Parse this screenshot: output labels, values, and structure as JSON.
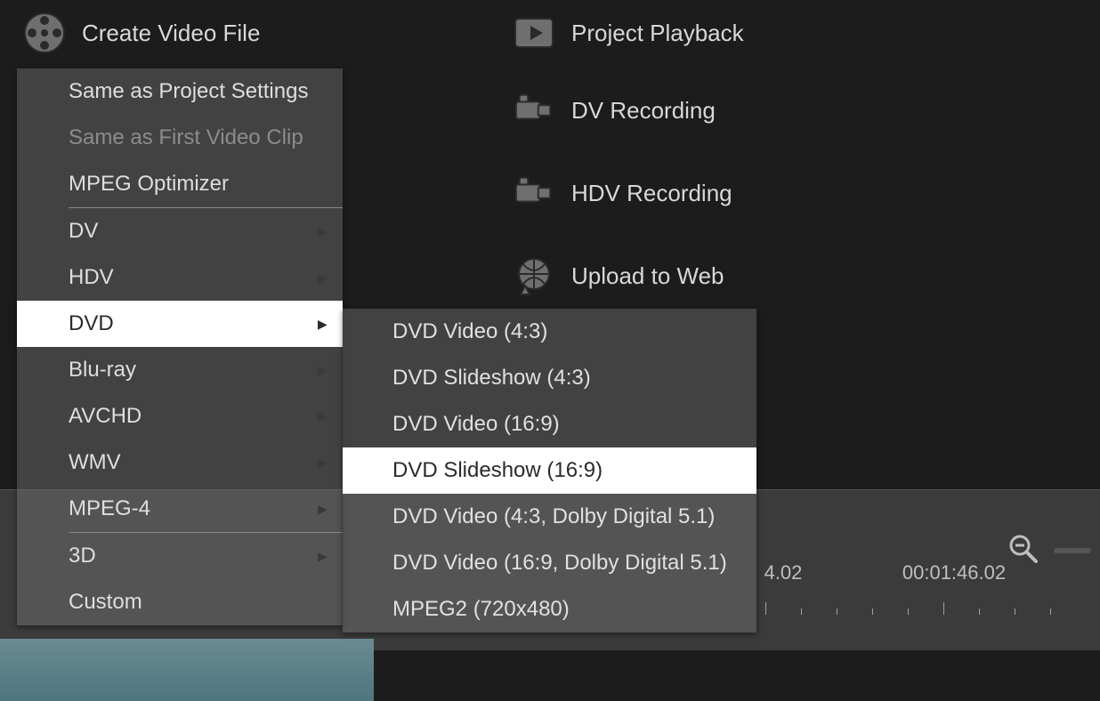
{
  "toolbar": {
    "create_video_file": "Create Video File",
    "project_playback": "Project Playback",
    "dv_recording": "DV Recording",
    "hdv_recording": "HDV Recording",
    "upload_to_web": "Upload to Web"
  },
  "menu": {
    "same_as_project_settings": "Same as Project Settings",
    "same_as_first_video_clip": "Same as First Video Clip",
    "mpeg_optimizer": "MPEG Optimizer",
    "dv": "DV",
    "hdv": "HDV",
    "dvd": "DVD",
    "bluray": "Blu-ray",
    "avchd": "AVCHD",
    "wmv": "WMV",
    "mpeg4": "MPEG-4",
    "three_d": "3D",
    "custom": "Custom"
  },
  "submenu": {
    "dvd_video_43": "DVD Video (4:3)",
    "dvd_slideshow_43": "DVD Slideshow (4:3)",
    "dvd_video_169": "DVD Video (16:9)",
    "dvd_slideshow_169": "DVD Slideshow (16:9)",
    "dvd_video_43_dolby": "DVD Video (4:3, Dolby Digital 5.1)",
    "dvd_video_169_dolby": "DVD Video (16:9, Dolby Digital 5.1)",
    "mpeg2_720x480": "MPEG2 (720x480)"
  },
  "timeline": {
    "t1": "4.02",
    "t2": "00:01:46.02"
  }
}
